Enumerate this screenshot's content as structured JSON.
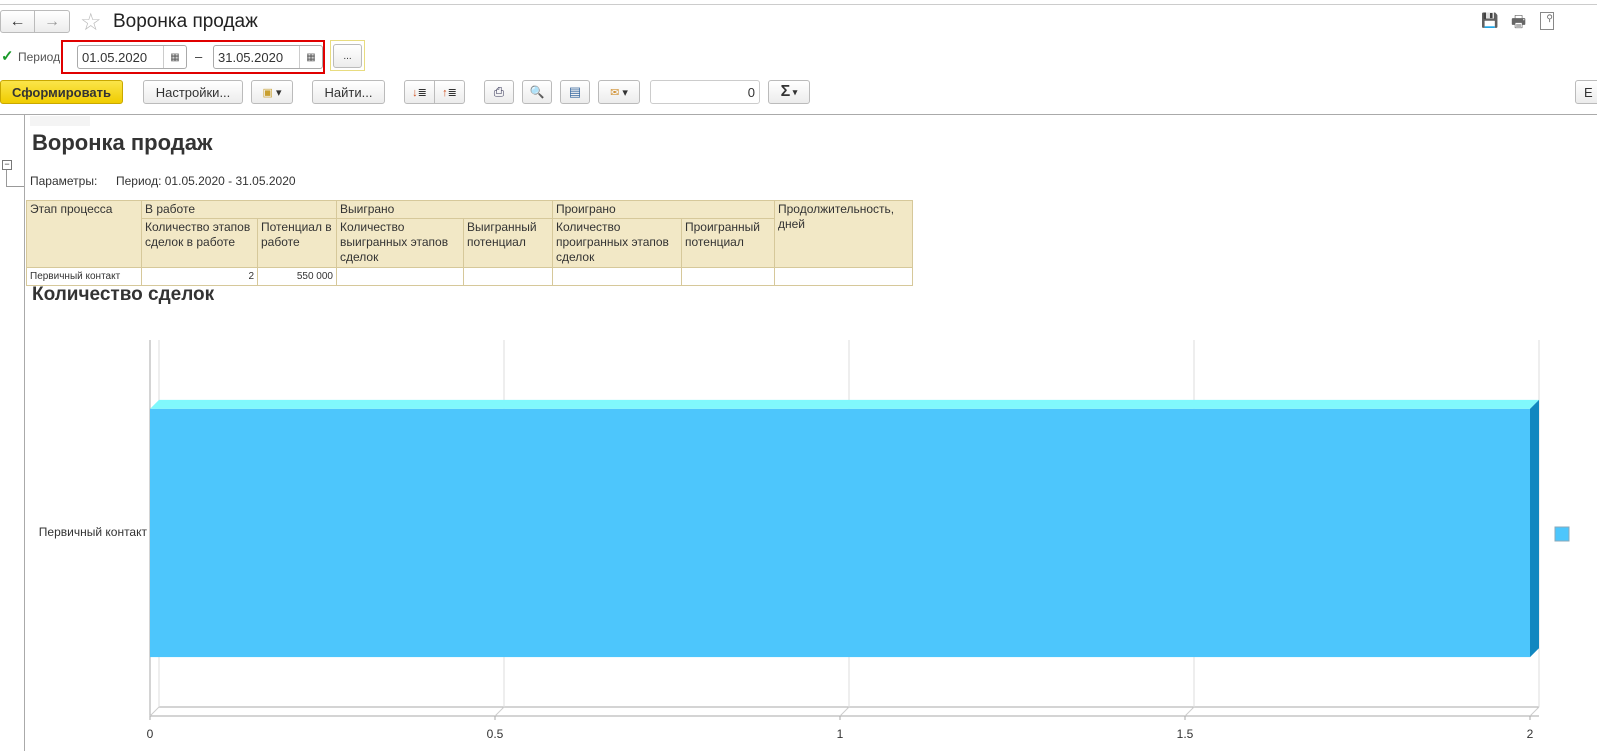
{
  "window": {
    "title": "Воронка продаж",
    "nav_back": "back-arrow-icon",
    "nav_forward": "forward-arrow-icon"
  },
  "period": {
    "label": "Период:",
    "checked": true,
    "from": "01.05.2020",
    "to": "31.05.2020",
    "dash": "–",
    "more": "..."
  },
  "toolbar": {
    "generate": "Сформировать",
    "settings": "Настройки...",
    "find": "Найти...",
    "counter": "0",
    "sum": "Σ",
    "right_button": "Е"
  },
  "report": {
    "title": "Воронка продаж",
    "params_label": "Параметры:",
    "params_value": "Период: 01.05.2020 - 31.05.2020",
    "table": {
      "group_headers": [
        "Этап процесса",
        "В работе",
        "Выиграно",
        "Проиграно",
        "Продолжительность, дней"
      ],
      "sub_headers": [
        "Количество этапов сделок в работе",
        "Потенциал в работе",
        "Количество выигранных этапов сделок",
        "Выигранный потенциал",
        "Количество проигранных этапов сделок",
        "Проигранный потенциал"
      ],
      "rows": [
        [
          "Первичный контакт",
          "2",
          "550 000",
          "",
          "",
          "",
          "",
          "",
          ""
        ]
      ]
    },
    "chart_title": "Количество сделок"
  },
  "chart_data": {
    "type": "bar",
    "orientation": "horizontal",
    "style": "3d",
    "title": "Количество сделок",
    "categories": [
      "Первичный контакт"
    ],
    "values": [
      2
    ],
    "xlim": [
      0,
      2
    ],
    "ticks": [
      "0",
      "0.5",
      "1",
      "1.5",
      "2"
    ],
    "grid": true,
    "legend": "right",
    "colors": {
      "bar": "#4dc6fc",
      "top": "#80f8fc",
      "side": "#1187c0"
    }
  },
  "colors": {
    "generate_button": "#f5d800",
    "highlight_border": "#e00000",
    "table_header": "#f2e8c6"
  }
}
